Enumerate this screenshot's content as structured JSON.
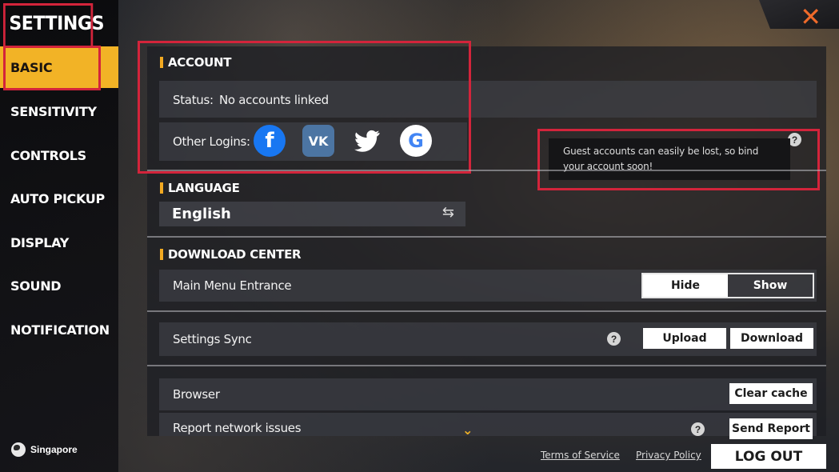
{
  "sidebar": {
    "title": "SETTINGS",
    "items": [
      {
        "label": "BASIC"
      },
      {
        "label": "SENSITIVITY"
      },
      {
        "label": "CONTROLS"
      },
      {
        "label": "AUTO PICKUP"
      },
      {
        "label": "DISPLAY"
      },
      {
        "label": "SOUND"
      },
      {
        "label": "NOTIFICATION"
      }
    ],
    "region": "Singapore"
  },
  "account": {
    "heading": "ACCOUNT",
    "status_label": "Status:",
    "status_value": "No accounts linked",
    "other_logins_label": "Other Logins:",
    "logins": [
      {
        "name": "facebook",
        "glyph": "f"
      },
      {
        "name": "vk",
        "glyph": "VK"
      },
      {
        "name": "twitter",
        "glyph": "🐦"
      },
      {
        "name": "google",
        "glyph": "G"
      }
    ],
    "tooltip": "Guest accounts can easily be lost, so bind your account soon!"
  },
  "language": {
    "heading": "LANGUAGE",
    "value": "English"
  },
  "download_center": {
    "heading": "DOWNLOAD CENTER",
    "main_menu_label": "Main Menu Entrance",
    "hide_label": "Hide",
    "show_label": "Show",
    "selected": "Hide"
  },
  "settings_sync": {
    "label": "Settings Sync",
    "upload_label": "Upload",
    "download_label": "Download"
  },
  "browser": {
    "label": "Browser",
    "clear_cache_label": "Clear cache"
  },
  "report": {
    "label": "Report network issues",
    "send_label": "Send Report"
  },
  "footer": {
    "terms": "Terms of Service",
    "privacy": "Privacy Policy",
    "logout": "LOG OUT"
  },
  "colors": {
    "accent": "#f2b326",
    "highlight_box": "#d3243b",
    "close": "#ef6a2a"
  }
}
